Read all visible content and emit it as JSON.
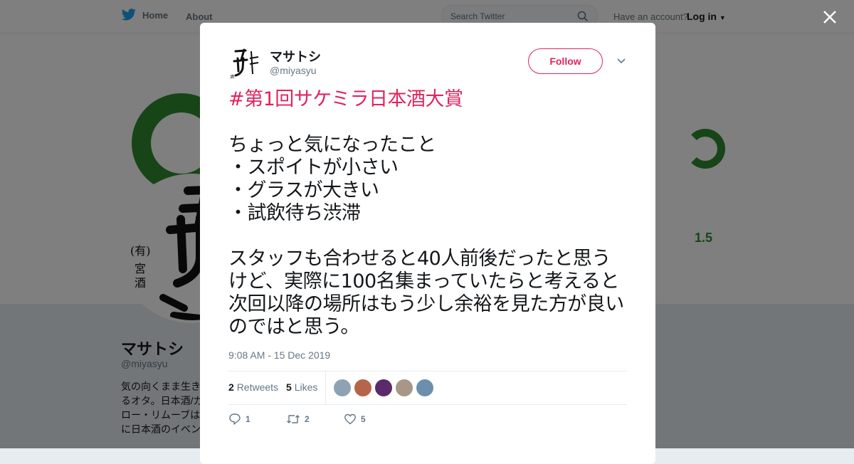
{
  "nav": {
    "home_label": "Home",
    "about_label": "About",
    "search_placeholder": "Search Twitter",
    "account_prompt": "Have an account?",
    "login_label": "Log in"
  },
  "profile": {
    "banner_number": "1.5",
    "name": "マサトシ",
    "handle": "@miyasyu",
    "bio_lines": [
      "気の向くまま生き",
      "るオタ。日本酒/ガ",
      "ロー・リムーブは",
      "に日本酒のイベン"
    ]
  },
  "tweet": {
    "author_name": "マサトシ",
    "author_handle": "@miyasyu",
    "follow_label": "Follow",
    "hashtag": "#第1回サケミラ日本酒大賞",
    "body": "\n\nちょっと気になったこと\n・スポイトが小さい\n・グラスが大きい\n・試飲待ち渋滞\n\nスタッフも合わせると40人前後だったと思うけど、実際に100名集まっていたらと考えると次回以降の場所はもう少し余裕を見た方が良いのではと思う。",
    "timestamp": "9:08 AM - 15 Dec 2019",
    "retweets_count": "2",
    "retweets_label": "Retweets",
    "likes_count": "5",
    "likes_label": "Likes",
    "liker_colors": [
      "#8da3b4",
      "#b5654a",
      "#5a2a6a",
      "#a89786",
      "#6d8fae"
    ],
    "reply_count": "1",
    "retweet_count": "2",
    "like_count": "5"
  },
  "colors": {
    "accent": "#e0245e",
    "twitter_blue": "#1da1f2",
    "banner_green": "#2f8a2f"
  }
}
